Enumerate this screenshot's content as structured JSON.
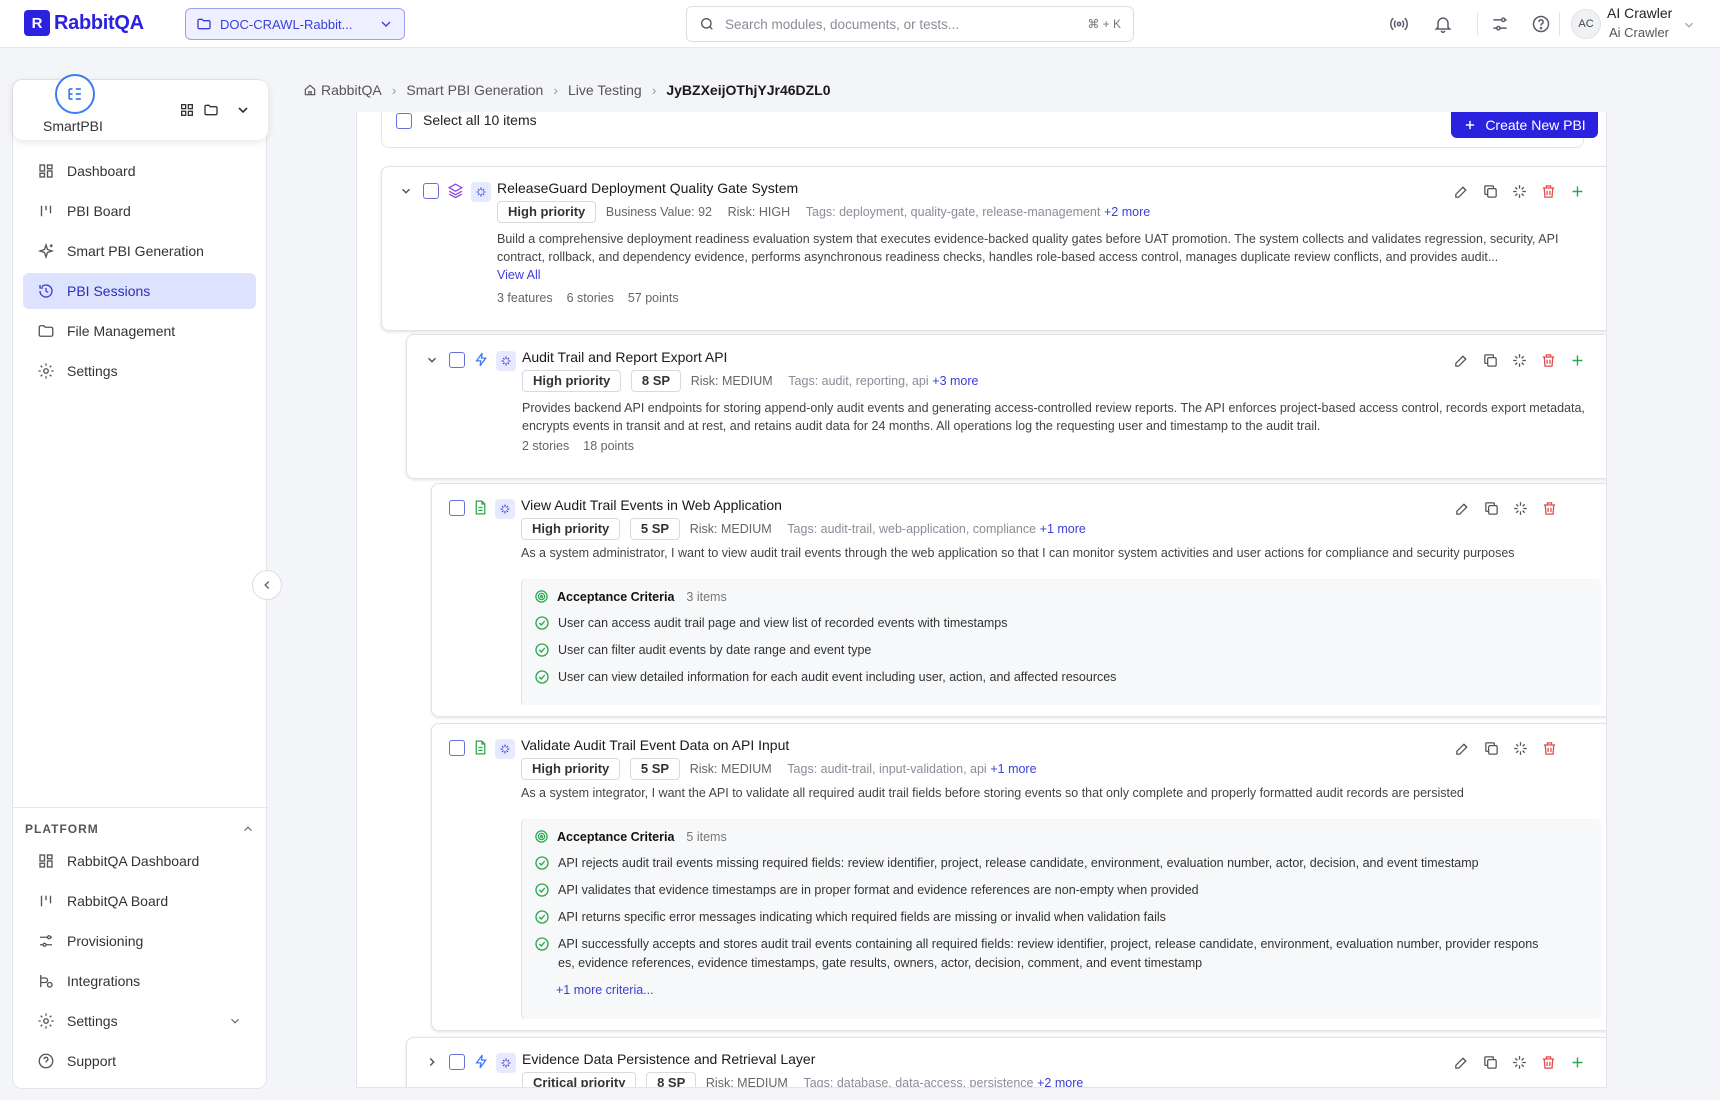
{
  "app": {
    "name": "RabbitQA"
  },
  "project": {
    "name": "DOC-CRAWL-Rabbit..."
  },
  "search": {
    "placeholder": "Search modules, documents, or tests...",
    "shortcut": "⌘ + K"
  },
  "user": {
    "initials": "AC",
    "name": "AI Crawler",
    "subtitle": "Ai Crawler"
  },
  "module": {
    "name": "SmartPBI"
  },
  "sidebar": {
    "items": [
      {
        "label": "Dashboard",
        "icon": "dashboard-icon"
      },
      {
        "label": "PBI Board",
        "icon": "board-icon"
      },
      {
        "label": "Smart PBI Generation",
        "icon": "sparkle-icon"
      },
      {
        "label": "PBI Sessions",
        "icon": "history-icon",
        "active": true
      },
      {
        "label": "File Management",
        "icon": "folder-icon"
      },
      {
        "label": "Settings",
        "icon": "gear-icon"
      }
    ],
    "platform_label": "PLATFORM",
    "platform_items": [
      {
        "label": "RabbitQA Dashboard",
        "icon": "dashboard-icon"
      },
      {
        "label": "RabbitQA Board",
        "icon": "board-icon"
      },
      {
        "label": "Provisioning",
        "icon": "sliders-icon"
      },
      {
        "label": "Integrations",
        "icon": "integrations-icon"
      },
      {
        "label": "Settings",
        "icon": "gear-icon"
      },
      {
        "label": "Support",
        "icon": "help-icon"
      }
    ]
  },
  "breadcrumb": [
    "RabbitQA",
    "Smart PBI Generation",
    "Live Testing",
    "JyBZXeijOThjYJr46DZL0"
  ],
  "toolbar": {
    "select_all": "Select all 10 items",
    "create": "Create New PBI"
  },
  "epic": {
    "title": "ReleaseGuard Deployment Quality Gate System",
    "priority": "High priority",
    "business_value": "Business Value: 92",
    "risk": "Risk: HIGH",
    "tags": "Tags: deployment, quality-gate, release-management",
    "more_tags": "+2 more",
    "description": "Build a comprehensive deployment readiness evaluation system that executes evidence-backed quality gates before UAT promotion. The system collects and validates regression, security, API contract, rollback, and dependency evidence, performs asynchronous readiness checks, handles role-based access control, manages duplicate review conflicts, and provides audit...",
    "view_all": "View All",
    "features": "3 features",
    "stories": "6 stories",
    "points": "57 points"
  },
  "feature1": {
    "title": "Audit Trail and Report Export API",
    "priority": "High priority",
    "sp": "8 SP",
    "risk": "Risk: MEDIUM",
    "tags": "Tags: audit, reporting, api",
    "more_tags": "+3 more",
    "description": "Provides backend API endpoints for storing append-only audit events and generating access-controlled review reports. The API enforces project-based access control, records export metadata, encrypts events in transit and at rest, and retains audit data for 24 months. All operations log the requesting user and timestamp to the audit trail.",
    "stories": "2 stories",
    "points": "18 points"
  },
  "story1": {
    "title": "View Audit Trail Events in Web Application",
    "priority": "High priority",
    "sp": "5 SP",
    "risk": "Risk: MEDIUM",
    "tags": "Tags: audit-trail, web-application, compliance",
    "more_tags": "+1 more",
    "description": "As a system administrator, I want to view audit trail events through the web application so that I can monitor system activities and user actions for compliance and security purposes",
    "ac_label": "Acceptance Criteria",
    "ac_count": "3 items",
    "criteria": [
      "User can access audit trail page and view list of recorded events with timestamps",
      "User can filter audit events by date range and event type",
      "User can view detailed information for each audit event including user, action, and affected resources"
    ]
  },
  "story2": {
    "title": "Validate Audit Trail Event Data on API Input",
    "priority": "High priority",
    "sp": "5 SP",
    "risk": "Risk: MEDIUM",
    "tags": "Tags: audit-trail, input-validation, api",
    "more_tags": "+1 more",
    "description": "As a system integrator, I want the API to validate all required audit trail fields before storing events so that only complete and properly formatted audit records are persisted",
    "ac_label": "Acceptance Criteria",
    "ac_count": "5 items",
    "criteria": [
      "API rejects audit trail events missing required fields: review identifier, project, release candidate, environment, evaluation number, actor, decision, and event timestamp",
      "API validates that evidence timestamps are in proper format and evidence references are non-empty when provided",
      "API returns specific error messages indicating which required fields are missing or invalid when validation fails",
      "API successfully accepts and stores audit trail events containing all required fields: review identifier, project, release candidate, environment, evaluation number, provider respons",
      "es, evidence references, evidence timestamps, gate results, owners, actor, decision, comment, and event timestamp"
    ],
    "more_criteria": "+1 more criteria..."
  },
  "feature2": {
    "title": "Evidence Data Persistence and Retrieval Layer",
    "priority": "Critical priority",
    "sp": "8 SP",
    "risk": "Risk: MEDIUM",
    "tags": "Tags: database, data-access, persistence",
    "more_tags": "+2 more"
  },
  "colors": {
    "accent": "#2b22e0",
    "active_nav_bg": "#dde2ff",
    "success": "#2aa84a",
    "danger": "#e14b4b"
  }
}
